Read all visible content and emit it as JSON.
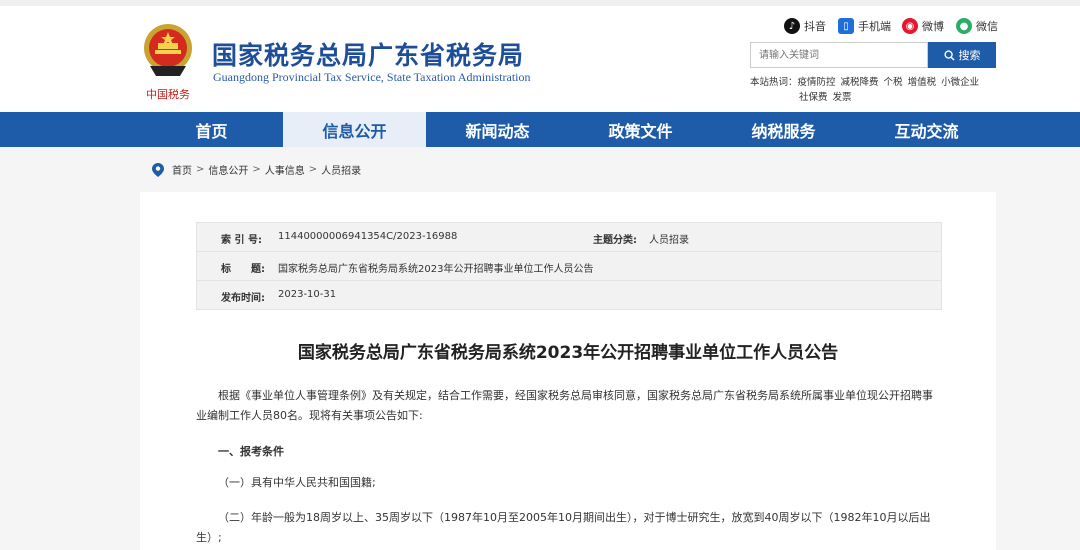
{
  "site": {
    "title_cn": "国家税务总局广东省税务局",
    "title_en": "Guangdong Provincial Tax Service, State Taxation Administration",
    "emblem_text": "中国税务"
  },
  "social": [
    {
      "label": "抖音",
      "icon": "tiktok-icon",
      "color": "#111111"
    },
    {
      "label": "手机端",
      "icon": "mobile-icon",
      "color": "#1e6fd9"
    },
    {
      "label": "微博",
      "icon": "weibo-icon",
      "color": "#e6162d"
    },
    {
      "label": "微信",
      "icon": "wechat-icon",
      "color": "#2aae67"
    }
  ],
  "search": {
    "placeholder": "请输入关键词",
    "button": "搜索"
  },
  "hot": {
    "label": "本站热词：",
    "words": [
      "疫情防控",
      "减税降费",
      "个税",
      "增值税",
      "小微企业",
      "社保费",
      "发票"
    ]
  },
  "nav": {
    "items": [
      "首页",
      "信息公开",
      "新闻动态",
      "政策文件",
      "纳税服务",
      "互动交流"
    ],
    "active": "信息公开"
  },
  "breadcrumb": [
    "首页",
    "信息公开",
    "人事信息",
    "人员招录"
  ],
  "meta": {
    "index_label": "索 引 号:",
    "index_value": "11440000006941354C/2023-16988",
    "category_label": "主题分类:",
    "category_value": "人员招录",
    "title_label": "标　　题:",
    "title_value": "国家税务总局广东省税务局系统2023年公开招聘事业单位工作人员公告",
    "date_label": "发布时间:",
    "date_value": "2023-10-31"
  },
  "article": {
    "title": "国家税务总局广东省税务局系统2023年公开招聘事业单位工作人员公告",
    "p1": "根据《事业单位人事管理条例》及有关规定，结合工作需要，经国家税务总局审核同意，国家税务总局广东省税务局系统所属事业单位现公开招聘事业编制工作人员80名。现将有关事项公告如下:",
    "h1": "一、报考条件",
    "p2": "（一）具有中华人民共和国国籍;",
    "p3": "（二）年龄一般为18周岁以上、35周岁以下（1987年10月至2005年10月期间出生），对于博士研究生，放宽到40周岁以下（1982年10月以后出生）;"
  },
  "colors": {
    "brand": "#1e5ba8",
    "nav_active_bg": "#e8eef7"
  }
}
